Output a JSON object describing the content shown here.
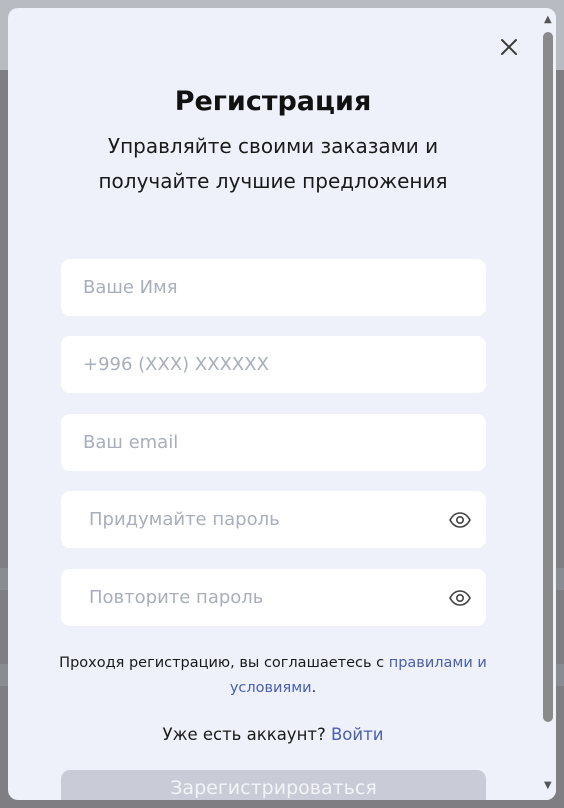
{
  "form": {
    "title": "Регистрация",
    "subtitle": "Управляйте своими заказами и получайте лучшие предложения",
    "name_placeholder": "Ваше Имя",
    "phone_placeholder": "+996 (XXX) XXXXXX",
    "email_placeholder": "Ваш email",
    "password_placeholder": "Придумайте пароль",
    "password_repeat_placeholder": "Повторите пароль",
    "agree_text": "Проходя регистрацию, вы соглашаетесь с",
    "agree_link": "правилами и условиями",
    "agree_end": ".",
    "have_account": "Уже есть аккаунт?",
    "login_link": "Войти",
    "submit_label": "Зарегистрироваться"
  },
  "icons": {
    "close": "close-icon",
    "eye": "eye-icon"
  },
  "colors": {
    "modal_bg": "#eef1fa",
    "link": "#4a5fad",
    "submit_disabled": "#c9ccd6"
  }
}
